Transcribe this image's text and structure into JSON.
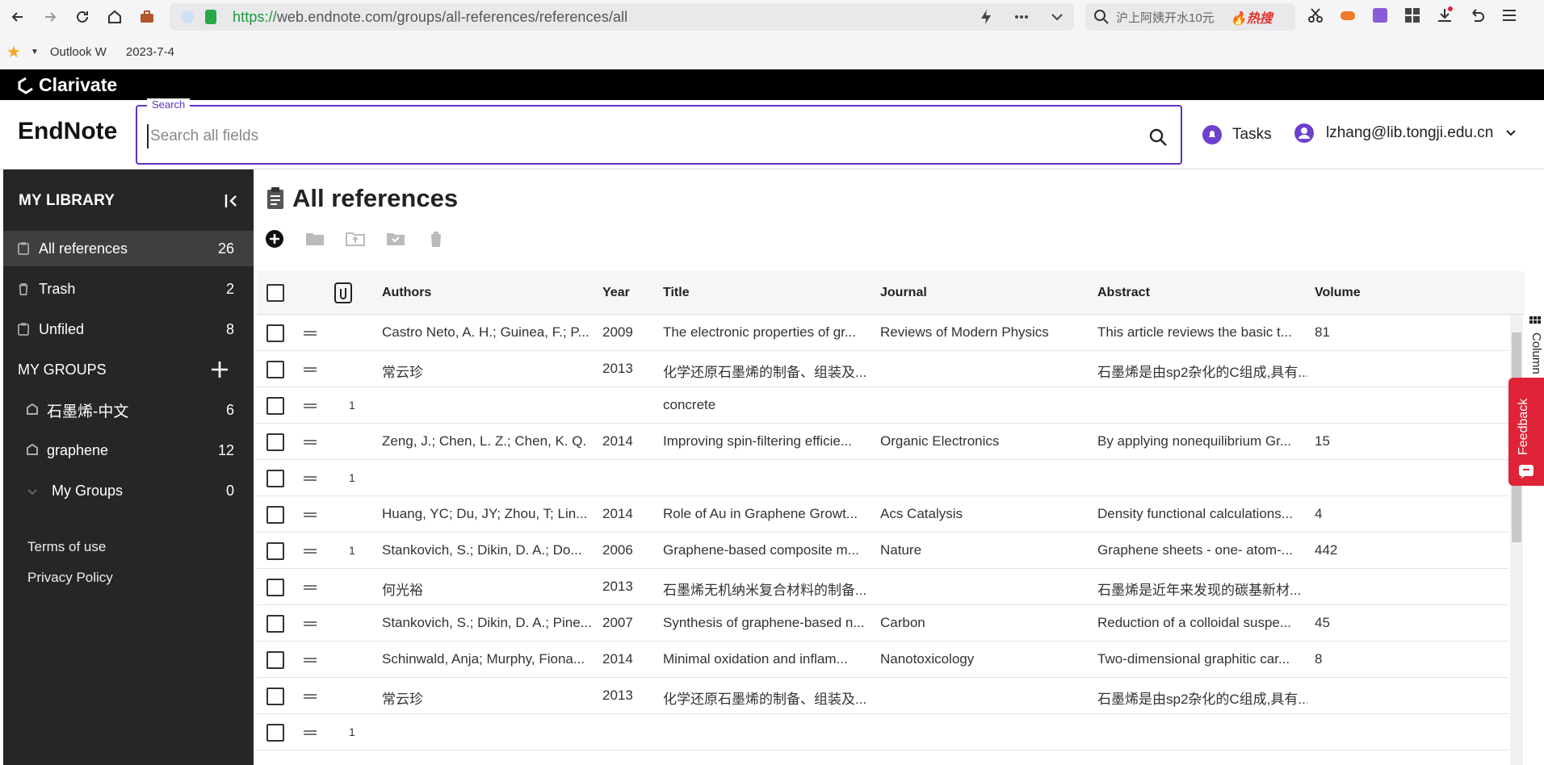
{
  "browser": {
    "url_scheme": "https://",
    "url_rest": "web.endnote.com/groups/all-references/references/all",
    "search_text": "沪上阿姨开水10元",
    "hot_label": "🔥热搜"
  },
  "bookmarks": {
    "items": [
      "Outlook W",
      "2023-7-4"
    ]
  },
  "brand": {
    "clarivate": "Clarivate",
    "endnote": "EndNote"
  },
  "search": {
    "label": "Search",
    "placeholder": "Search all fields"
  },
  "header": {
    "tasks_label": "Tasks",
    "user_email": "lzhang@lib.tongji.edu.cn"
  },
  "sidebar": {
    "title": "MY LIBRARY",
    "items": [
      {
        "label": "All references",
        "count": "26"
      },
      {
        "label": "Trash",
        "count": "2"
      },
      {
        "label": "Unfiled",
        "count": "8"
      }
    ],
    "groups_title": "MY GROUPS",
    "groups": [
      {
        "label": "石墨烯-中文",
        "count": "6"
      },
      {
        "label": "graphene",
        "count": "12"
      },
      {
        "label": "My Groups",
        "count": "0"
      }
    ],
    "terms": "Terms of use",
    "privacy": "Privacy Policy"
  },
  "main": {
    "title": "All references"
  },
  "table": {
    "headers": {
      "authors": "Authors",
      "year": "Year",
      "title": "Title",
      "journal": "Journal",
      "abstract": "Abstract",
      "volume": "Volume"
    },
    "rows": [
      {
        "att": "",
        "authors": "Castro Neto, A. H.; Guinea, F.; P...",
        "year": "2009",
        "title": "The electronic properties of gr...",
        "journal": "Reviews of Modern Physics",
        "abstract": "This article reviews the basic t...",
        "volume": "81"
      },
      {
        "att": "",
        "authors": "常云珍",
        "year": "2013",
        "title": "化学还原石墨烯的制备、组装及...",
        "journal": "",
        "abstract": "石墨烯是由sp2杂化的C组成,具有...",
        "volume": ""
      },
      {
        "att": "1",
        "authors": "",
        "year": "",
        "title": "concrete",
        "journal": "",
        "abstract": "",
        "volume": ""
      },
      {
        "att": "",
        "authors": "Zeng, J.; Chen, L. Z.; Chen, K. Q.",
        "year": "2014",
        "title": "Improving spin-filtering efficie...",
        "journal": "Organic Electronics",
        "abstract": "By applying nonequilibrium Gr...",
        "volume": "15"
      },
      {
        "att": "1",
        "authors": "",
        "year": "",
        "title": "",
        "journal": "",
        "abstract": "",
        "volume": ""
      },
      {
        "att": "",
        "authors": "Huang, YC; Du, JY; Zhou, T; Lin...",
        "year": "2014",
        "title": "Role of Au in Graphene Growt...",
        "journal": "Acs Catalysis",
        "abstract": "Density functional calculations...",
        "volume": "4"
      },
      {
        "att": "1",
        "authors": "Stankovich, S.; Dikin, D. A.; Do...",
        "year": "2006",
        "title": "Graphene-based composite m...",
        "journal": "Nature",
        "abstract": "Graphene sheets - one- atom-...",
        "volume": "442"
      },
      {
        "att": "",
        "authors": "何光裕",
        "year": "2013",
        "title": "石墨烯无机纳米复合材料的制备...",
        "journal": "",
        "abstract": "石墨烯是近年来发现的碳基新材...",
        "volume": ""
      },
      {
        "att": "",
        "authors": "Stankovich, S.; Dikin, D. A.; Pine...",
        "year": "2007",
        "title": "Synthesis of graphene-based n...",
        "journal": "Carbon",
        "abstract": "Reduction of a colloidal suspe...",
        "volume": "45"
      },
      {
        "att": "",
        "authors": "Schinwald, Anja; Murphy, Fiona...",
        "year": "2014",
        "title": "Minimal oxidation and inflam...",
        "journal": "Nanotoxicology",
        "abstract": "Two-dimensional graphitic car...",
        "volume": "8"
      },
      {
        "att": "",
        "authors": "常云珍",
        "year": "2013",
        "title": "化学还原石墨烯的制备、组装及...",
        "journal": "",
        "abstract": "石墨烯是由sp2杂化的C组成,具有...",
        "volume": ""
      },
      {
        "att": "1",
        "authors": "",
        "year": "",
        "title": "",
        "journal": "",
        "abstract": "",
        "volume": ""
      }
    ]
  },
  "side_tabs": {
    "columns": "Column",
    "feedback": "Feedback"
  },
  "colors": {
    "accent": "#5e33bf",
    "sidebar_bg": "#262626",
    "feedback": "#e02438"
  }
}
